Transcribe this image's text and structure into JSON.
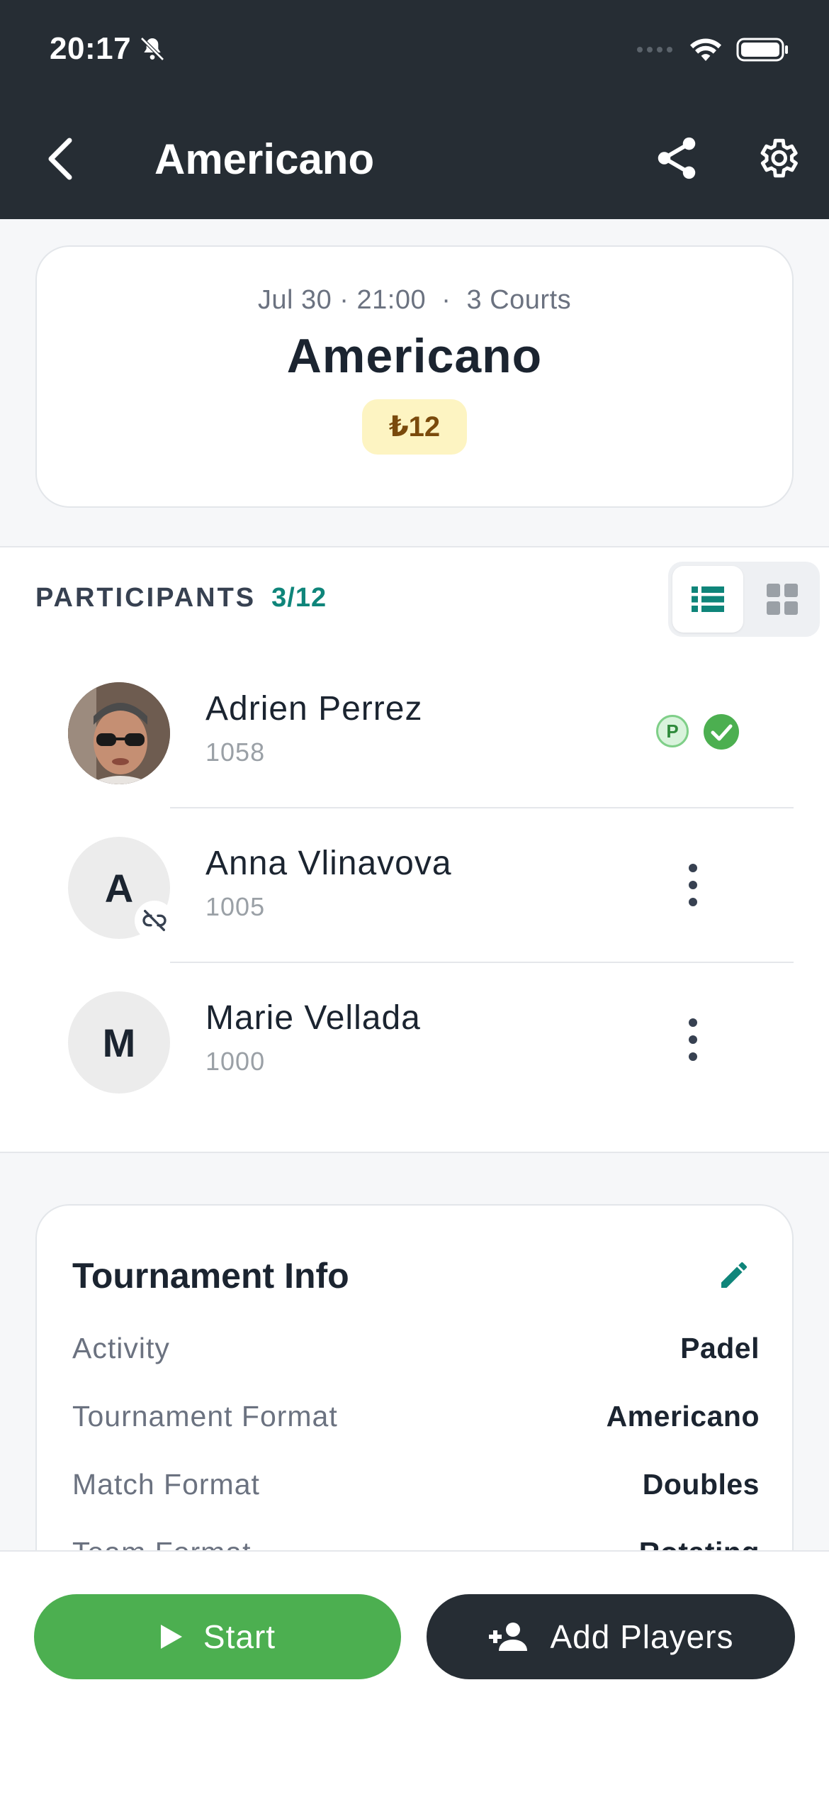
{
  "status_bar": {
    "time": "20:17"
  },
  "nav": {
    "title": "Americano"
  },
  "event": {
    "date_time": "Jul 30 · 21:00",
    "courts": "3 Courts",
    "title": "Americano",
    "price": "₺12"
  },
  "participants": {
    "label": "PARTICIPANTS",
    "count": "3/12",
    "players": [
      {
        "name": "Adrien Perrez",
        "rating": "1058",
        "initial": ""
      },
      {
        "name": "Anna Vlinavova",
        "rating": "1005",
        "initial": "A"
      },
      {
        "name": "Marie Vellada",
        "rating": "1000",
        "initial": "M"
      }
    ],
    "badge_p": "P"
  },
  "tournament_info": {
    "title": "Tournament Info",
    "rows": [
      {
        "label": "Activity",
        "value": "Padel"
      },
      {
        "label": "Tournament Format",
        "value": "Americano"
      },
      {
        "label": "Match Format",
        "value": "Doubles"
      },
      {
        "label": "Team Format",
        "value": "Rotating"
      }
    ]
  },
  "actions": {
    "start": "Start",
    "add_players": "Add Players"
  },
  "colors": {
    "header": "#262d34",
    "accent": "#0f857a",
    "start": "#4caf50",
    "price_bg": "#fdf4c2"
  }
}
